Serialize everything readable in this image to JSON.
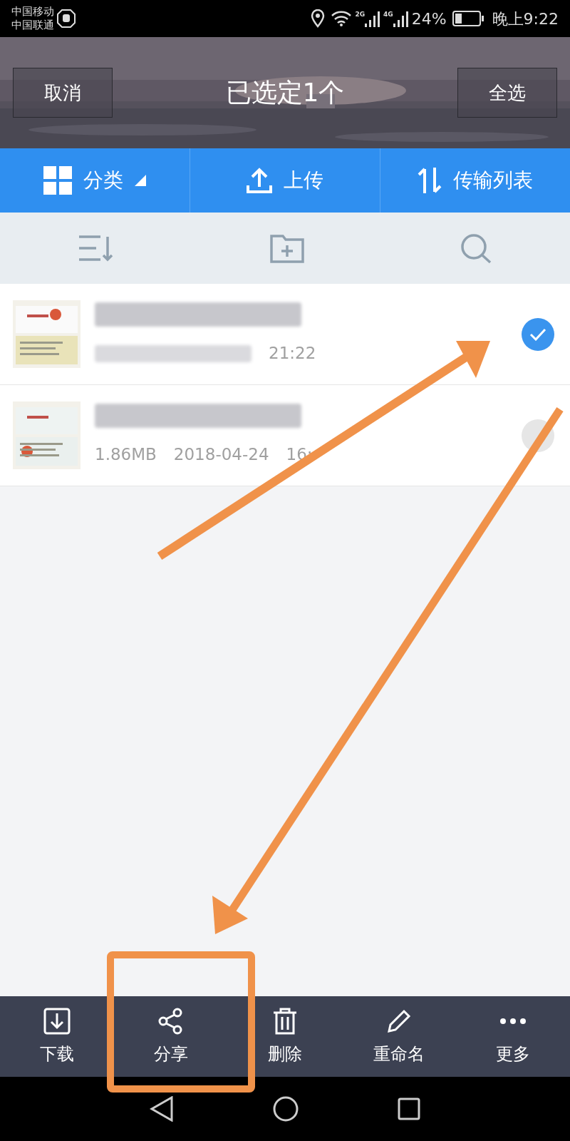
{
  "status_bar": {
    "carriers": [
      "中国移动",
      "中国联通"
    ],
    "network_labels": [
      "2G",
      "4G"
    ],
    "battery": "24%",
    "time": "晚上9:22"
  },
  "header": {
    "cancel": "取消",
    "title": "已选定1个",
    "select_all": "全选"
  },
  "tabs": [
    {
      "label": "分类",
      "kind": "category"
    },
    {
      "label": "上传",
      "kind": "upload"
    },
    {
      "label": "传输列表",
      "kind": "transfer"
    }
  ],
  "files": [
    {
      "meta": [
        "21:22"
      ],
      "selected": true
    },
    {
      "meta": [
        "1.86MB",
        "2018-04-24",
        "16:"
      ],
      "selected": false
    }
  ],
  "actions": [
    {
      "label": "下载",
      "kind": "download"
    },
    {
      "label": "分享",
      "kind": "share"
    },
    {
      "label": "删除",
      "kind": "delete"
    },
    {
      "label": "重命名",
      "kind": "rename"
    },
    {
      "label": "更多",
      "kind": "more"
    }
  ]
}
